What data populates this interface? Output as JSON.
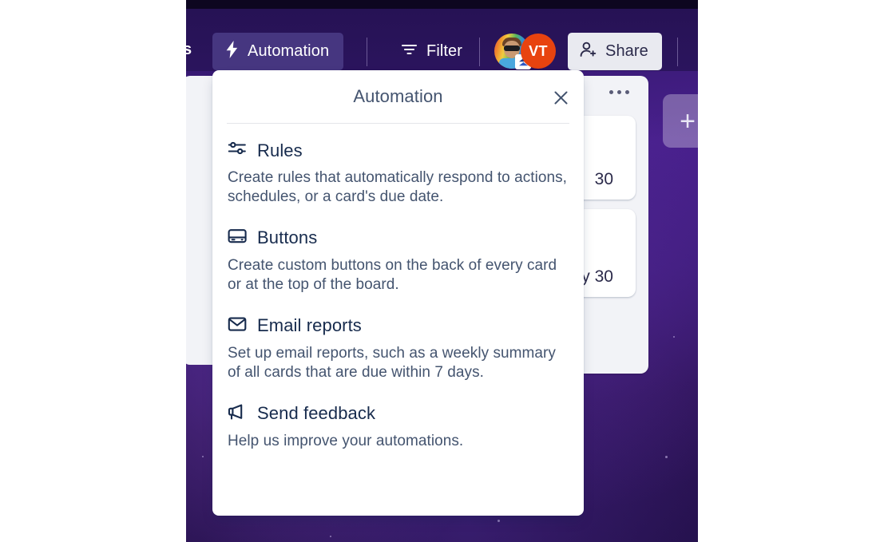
{
  "board_header": {
    "truncated_label": "s",
    "automation_button": {
      "label": "Automation",
      "icon": "lightning-bolt-icon"
    },
    "filter_button": {
      "label": "Filter",
      "icon": "filter-icon"
    },
    "members": [
      {
        "name": "member-avatar-photo",
        "initials": "",
        "badge": "premium-badge-icon"
      },
      {
        "name": "member-avatar-initials",
        "initials": "VT",
        "color": "#e8430f"
      }
    ],
    "share_button": {
      "label": "Share",
      "icon": "person-add-icon"
    }
  },
  "board": {
    "list_menu_icon": "more-options-icon",
    "add_list_button_label": "+",
    "cards": [
      {
        "text": "30"
      },
      {
        "text": "y 30"
      }
    ],
    "list_footer_icon": "card-template-icon"
  },
  "popup": {
    "title": "Automation",
    "close_icon": "close-icon",
    "sections": [
      {
        "icon": "sliders-icon",
        "title": "Rules",
        "description": "Create rules that automatically respond to actions, schedules, or a card's due date."
      },
      {
        "icon": "board-button-icon",
        "title": "Buttons",
        "description": "Create custom buttons on the back of every card or at the top of the board."
      },
      {
        "icon": "envelope-icon",
        "title": "Email reports",
        "description": "Set up email reports, such as a weekly summary of all cards that are due within 7 days."
      },
      {
        "icon": "megaphone-icon",
        "title": "Send feedback",
        "description": "Help us improve your automations."
      }
    ]
  },
  "colors": {
    "board_purple": "#3a1a77",
    "popup_title": "#44546f",
    "section_title": "#172b4d",
    "avatar_orange": "#e8430f",
    "automation_button_bg": "#463680"
  }
}
